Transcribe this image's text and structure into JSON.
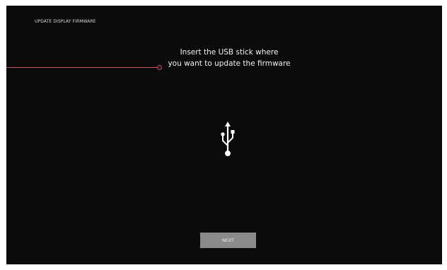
{
  "screen": {
    "title": "UPDATE DISPLAY FIRMWARE",
    "instruction_line1": "Insert the USB stick where",
    "instruction_line2": "you want to update the firmware",
    "icon": "usb-icon",
    "next_label": "NEXT"
  },
  "colors": {
    "background": "#0b0b0e",
    "text": "#ffffff",
    "button": "#8a8a8c",
    "callout": "#c8585c"
  }
}
